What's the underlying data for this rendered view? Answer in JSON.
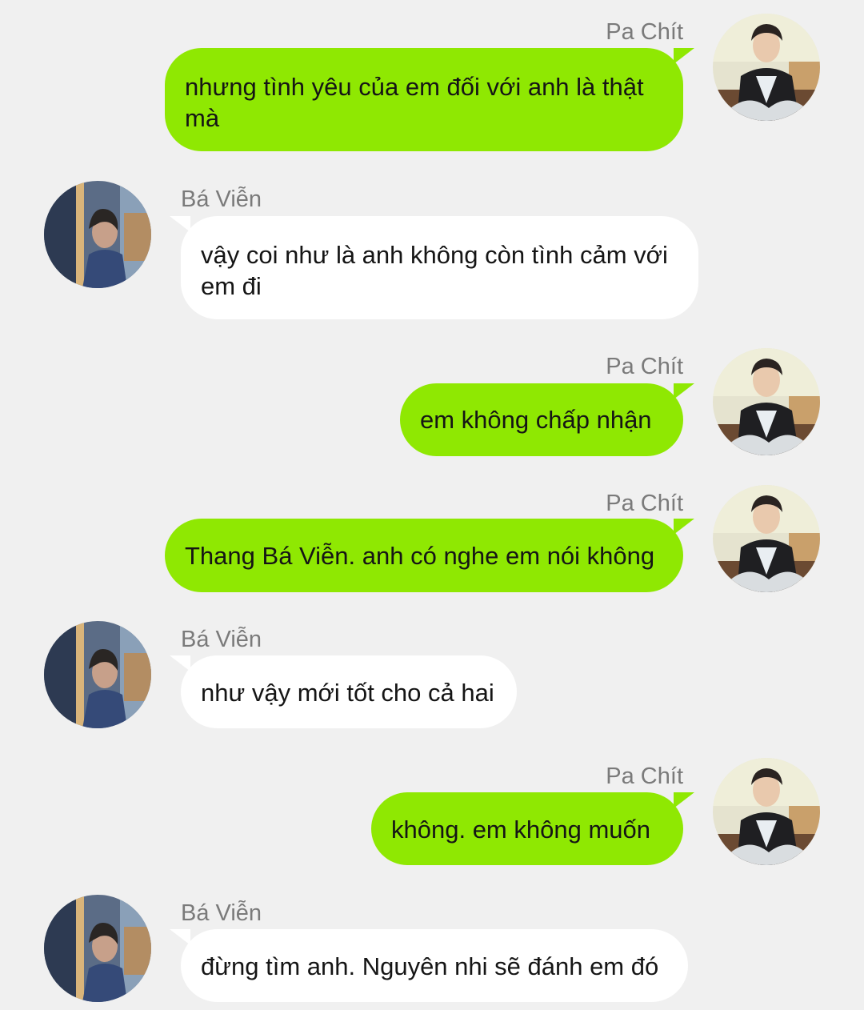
{
  "contacts": {
    "sender_name": "Pa Chít",
    "receiver_name": "Bá Viễn"
  },
  "messages": [
    {
      "from": "Pa Chít",
      "side": "right",
      "text": "nhưng tình yêu của em đối với anh là thật mà"
    },
    {
      "from": "Bá Viễn",
      "side": "left",
      "text": "vậy coi như là anh không còn tình cảm với em đi"
    },
    {
      "from": "Pa Chít",
      "side": "right",
      "text": "em không chấp nhận"
    },
    {
      "from": "Pa Chít",
      "side": "right",
      "text": "Thang Bá Viễn. anh có nghe em nói không"
    },
    {
      "from": "Bá Viễn",
      "side": "left",
      "text": "như vậy mới tốt cho cả hai"
    },
    {
      "from": "Pa Chít",
      "side": "right",
      "text": "không. em không muốn"
    },
    {
      "from": "Bá Viễn",
      "side": "left",
      "text": "đừng tìm anh. Nguyên nhi sẽ đánh em đó"
    }
  ],
  "colors": {
    "background": "#f0f0f0",
    "sent_bubble": "#8fe802",
    "received_bubble": "#ffffff",
    "name_text": "#7a7a7a",
    "message_text": "#151515"
  },
  "icons": {
    "sender_avatar": "avatar-photo-man-sitting-black-jacket",
    "receiver_avatar": "avatar-photo-person-profile-window"
  }
}
